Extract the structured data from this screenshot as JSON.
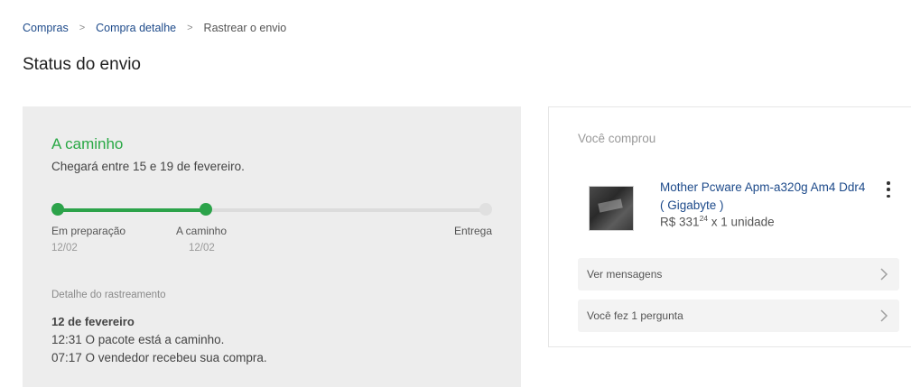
{
  "breadcrumb": {
    "items": [
      "Compras",
      "Compra detalhe",
      "Rastrear o envio"
    ],
    "separator": ">"
  },
  "page_title": "Status do envio",
  "shipment": {
    "status": "A caminho",
    "status_color": "#29a845",
    "eta": "Chegará entre 15 e 19 de fevereiro.",
    "progress": 0.35,
    "steps": [
      {
        "label": "Em preparação",
        "date": "12/02",
        "done": true
      },
      {
        "label": "A caminho",
        "date": "12/02",
        "done": true
      },
      {
        "label": "Entrega",
        "date": "",
        "done": false
      }
    ],
    "tracking": {
      "title": "Detalhe do rastreamento",
      "date": "12 de fevereiro",
      "events": [
        "12:31 O pacote está a caminho.",
        "07:17 O vendedor recebeu sua compra."
      ]
    }
  },
  "purchase": {
    "title": "Você comprou",
    "product": {
      "name": "Mother Pcware Apm-a320g Am4 Ddr4 ( Gigabyte )",
      "currency": "R$",
      "price_int": "331",
      "price_cents": "24",
      "quantity_text": "x 1 unidade",
      "thumb_icon": "motherboard-product-image"
    },
    "menu_icon": "kebab-menu-icon",
    "actions": [
      {
        "label": "Ver mensagens",
        "icon": "chevron-right-icon"
      },
      {
        "label": "Você fez 1 pergunta",
        "icon": "chevron-right-icon"
      }
    ]
  },
  "colors": {
    "link": "#1d4a8a",
    "success": "#2ca34a",
    "card_bg": "#ededed"
  }
}
